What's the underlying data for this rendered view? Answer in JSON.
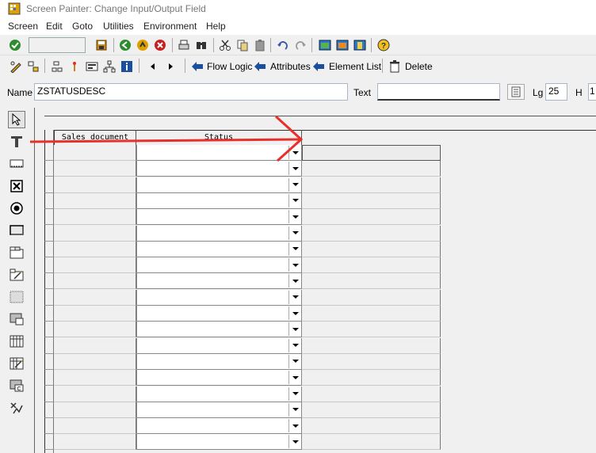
{
  "window": {
    "title": "Screen Painter: Change Input/Output Field"
  },
  "menu": {
    "items": [
      "Screen",
      "Edit",
      "Goto",
      "Utilities",
      "Environment",
      "Help"
    ]
  },
  "toolbar2": {
    "flow_logic": "Flow Logic",
    "attributes": "Attributes",
    "element_list": "Element List",
    "delete": "Delete"
  },
  "namebar": {
    "name_label": "Name",
    "name_value": "ZSTATUSDESC",
    "text_label": "Text",
    "text_value": "",
    "lg_label": "Lg",
    "lg_value": "25",
    "h_label": "H",
    "h_value": "1"
  },
  "table": {
    "columns": [
      "Sales document",
      "Status"
    ],
    "row_count": 19
  },
  "colors": {
    "annotation_arrow": "#e8302a",
    "background": "#f0f0f0"
  },
  "icons": {
    "palette": [
      "pointer-icon",
      "text-field-icon",
      "input-field-icon",
      "checkbox-icon",
      "radio-button-icon",
      "pushbutton-icon",
      "tabstrip-icon",
      "tabstrip-wizard-icon",
      "box-icon",
      "subscreen-icon",
      "table-control-icon",
      "table-wizard-icon",
      "custom-control-icon",
      "status-icon"
    ]
  }
}
